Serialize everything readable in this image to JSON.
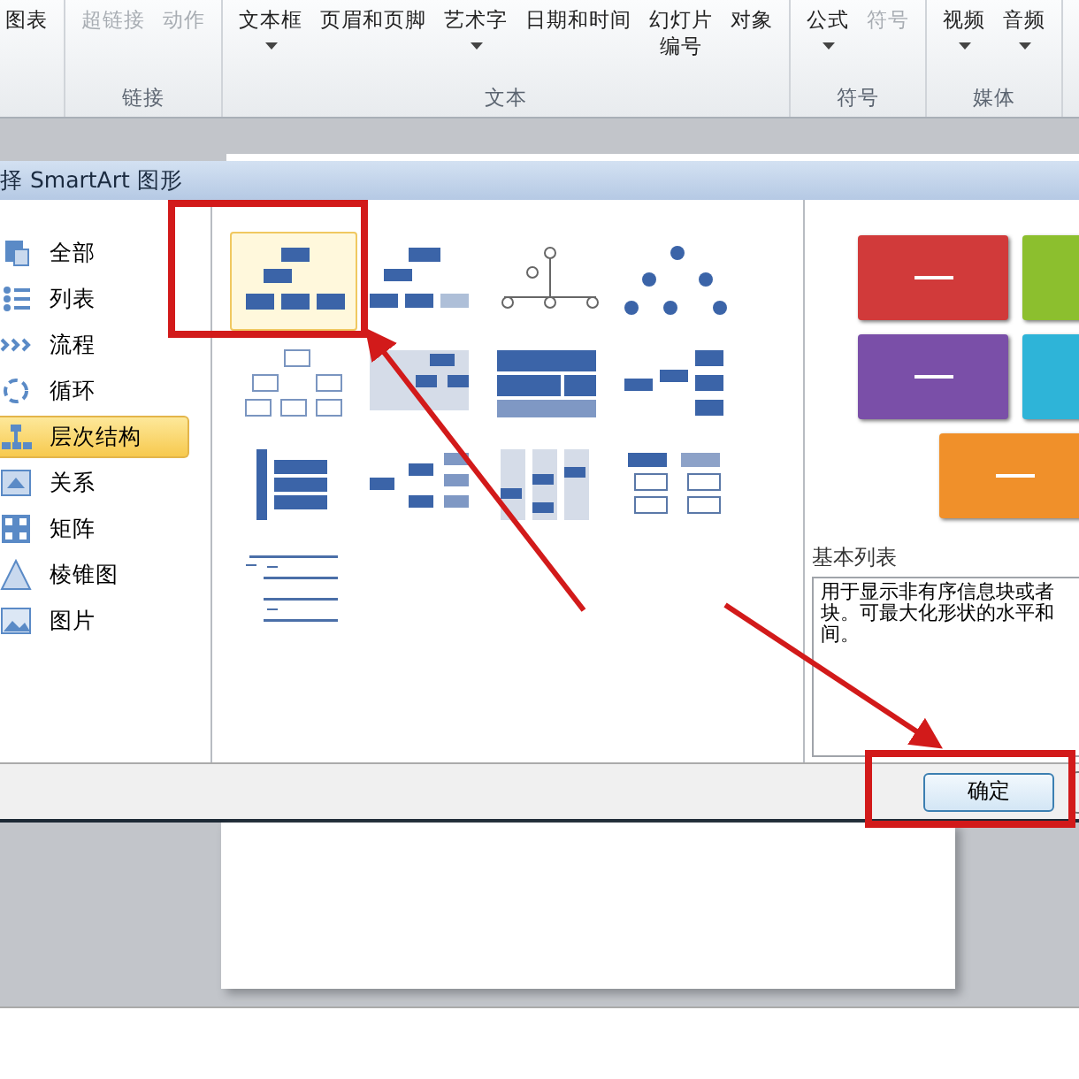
{
  "ribbon": {
    "groups": [
      {
        "items": [
          {
            "lines": [
              "图表"
            ],
            "dropdown": false,
            "disabled": false
          }
        ]
      },
      {
        "label": "链接",
        "items": [
          {
            "lines": [
              "超链接"
            ],
            "dropdown": false,
            "disabled": true
          },
          {
            "lines": [
              "动作"
            ],
            "dropdown": false,
            "disabled": true
          }
        ]
      },
      {
        "label": "文本",
        "items": [
          {
            "lines": [
              "文本框"
            ],
            "dropdown": true,
            "disabled": false
          },
          {
            "lines": [
              "页眉和页脚"
            ],
            "dropdown": false,
            "disabled": false
          },
          {
            "lines": [
              "艺术字"
            ],
            "dropdown": true,
            "disabled": false
          },
          {
            "lines": [
              "日期和时间"
            ],
            "dropdown": false,
            "disabled": false
          },
          {
            "lines": [
              "幻灯片",
              "编号"
            ],
            "dropdown": false,
            "disabled": false
          },
          {
            "lines": [
              "对象"
            ],
            "dropdown": false,
            "disabled": false
          }
        ]
      },
      {
        "label": "符号",
        "items": [
          {
            "lines": [
              "公式"
            ],
            "dropdown": true,
            "disabled": false
          },
          {
            "lines": [
              "符号"
            ],
            "dropdown": false,
            "disabled": true
          }
        ]
      },
      {
        "label": "媒体",
        "items": [
          {
            "lines": [
              "视频"
            ],
            "dropdown": true,
            "disabled": false
          },
          {
            "lines": [
              "音频"
            ],
            "dropdown": true,
            "disabled": false
          }
        ]
      }
    ]
  },
  "dialog": {
    "title": "择 SmartArt 图形",
    "categories": [
      {
        "label": "全部",
        "selected": false
      },
      {
        "label": "列表",
        "selected": false
      },
      {
        "label": "流程",
        "selected": false
      },
      {
        "label": "循环",
        "selected": false
      },
      {
        "label": "层次结构",
        "selected": true
      },
      {
        "label": "关系",
        "selected": false
      },
      {
        "label": "矩阵",
        "selected": false
      },
      {
        "label": "棱锥图",
        "selected": false
      },
      {
        "label": "图片",
        "selected": false
      }
    ],
    "gallery": [
      {
        "selected": true
      },
      {
        "selected": false
      },
      {
        "selected": false
      },
      {
        "selected": false
      },
      {
        "selected": false
      },
      {
        "selected": false
      },
      {
        "selected": false
      },
      {
        "selected": false
      },
      {
        "selected": false
      },
      {
        "selected": false
      },
      {
        "selected": false
      },
      {
        "selected": false
      },
      {
        "selected": false
      }
    ],
    "preview": {
      "blocks": [
        {
          "color": "#d13a3a"
        },
        {
          "color": "#8cbf2e"
        },
        {
          "color": "#7a4fa8"
        },
        {
          "color": "#2eb4d8"
        },
        {
          "color": "#f0902a"
        }
      ],
      "title": "基本列表",
      "description": [
        "用于显示非有序信息块或者",
        "块。可最大化形状的水平和",
        "间。"
      ]
    },
    "buttons": [
      "确定"
    ]
  }
}
